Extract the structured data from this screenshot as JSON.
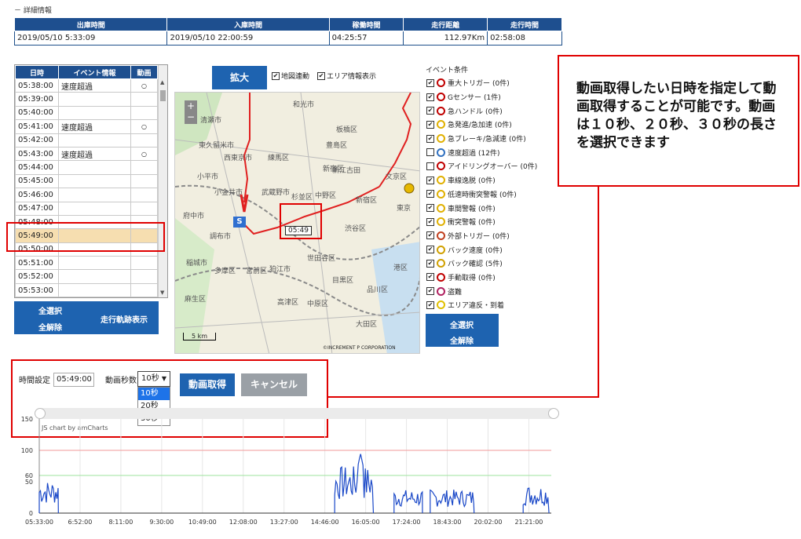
{
  "detail": {
    "section_label": "－ 詳細情報",
    "headers": [
      "出庫時間",
      "入庫時間",
      "稼働時間",
      "走行距離",
      "走行時間"
    ],
    "values": [
      "2019/05/10 5:33:09",
      "2019/05/10 22:00:59",
      "04:25:57",
      "112.97Km",
      "02:58:08"
    ]
  },
  "events": {
    "headers": [
      "日時",
      "イベント情報",
      "動画"
    ],
    "rows": [
      {
        "time": "05:38:00",
        "event": "速度超過",
        "video": "○"
      },
      {
        "time": "05:39:00",
        "event": "",
        "video": ""
      },
      {
        "time": "05:40:00",
        "event": "",
        "video": ""
      },
      {
        "time": "05:41:00",
        "event": "速度超過",
        "video": "○"
      },
      {
        "time": "05:42:00",
        "event": "",
        "video": ""
      },
      {
        "time": "05:43:00",
        "event": "速度超過",
        "video": "○"
      },
      {
        "time": "05:44:00",
        "event": "",
        "video": ""
      },
      {
        "time": "05:45:00",
        "event": "",
        "video": ""
      },
      {
        "time": "05:46:00",
        "event": "",
        "video": ""
      },
      {
        "time": "05:47:00",
        "event": "",
        "video": ""
      },
      {
        "time": "05:48:00",
        "event": "",
        "video": ""
      },
      {
        "time": "05:49:00",
        "event": "",
        "video": ""
      },
      {
        "time": "05:50:00",
        "event": "",
        "video": ""
      },
      {
        "time": "05:51:00",
        "event": "",
        "video": ""
      },
      {
        "time": "05:52:00",
        "event": "",
        "video": ""
      },
      {
        "time": "05:53:00",
        "event": "",
        "video": ""
      }
    ],
    "selected_index": 11,
    "select_all": "全選択",
    "clear_all": "全解除",
    "show_track": "走行軌跡表示"
  },
  "map": {
    "expand": "拡大",
    "sync_label": "地図連動",
    "area_label": "エリア情報表示",
    "sync_checked": true,
    "area_checked": true,
    "start_marker": "S",
    "time_marker": "05:49",
    "scale": "5 km",
    "copyright": "©INCREMENT P CORPORATION",
    "place_labels": [
      "清瀬市",
      "和光市",
      "板橋区",
      "東久留米市",
      "西東京市",
      "練馬区",
      "小平市",
      "豊島区",
      "小金井市",
      "武蔵野市",
      "新宿区",
      "中野区",
      "府中市",
      "調布市",
      "杉並区",
      "渋谷区",
      "世田谷区",
      "稲城市",
      "多摩区",
      "狛江市",
      "宮前区",
      "目黒区",
      "品川区",
      "麻生区",
      "高津区",
      "大田区",
      "中原区",
      "新宿区",
      "文京区",
      "港区",
      "新江古田",
      "東京"
    ],
    "zoom_in": "+",
    "zoom_out": "−"
  },
  "conditions": {
    "title": "イベント条件",
    "items": [
      {
        "label": "重大トリガー",
        "count": "(0件)",
        "checked": true,
        "color": "#c00000"
      },
      {
        "label": "Gセンサー",
        "count": "(1件)",
        "checked": true,
        "color": "#c00000"
      },
      {
        "label": "急ハンドル",
        "count": "(0件)",
        "checked": true,
        "color": "#c00000"
      },
      {
        "label": "急発進/急加速",
        "count": "(0件)",
        "checked": true,
        "color": "#e0b000"
      },
      {
        "label": "急ブレーキ/急減速",
        "count": "(0件)",
        "checked": true,
        "color": "#e0b000"
      },
      {
        "label": "速度超過",
        "count": "(12件)",
        "checked": false,
        "color": "#3070c0"
      },
      {
        "label": "アイドリングオーバー",
        "count": "(0件)",
        "checked": false,
        "color": "#c00000"
      },
      {
        "label": "車線逸脱",
        "count": "(0件)",
        "checked": true,
        "color": "#e0b000"
      },
      {
        "label": "低速時衝突警報",
        "count": "(0件)",
        "checked": true,
        "color": "#e0b000"
      },
      {
        "label": "車間警報",
        "count": "(0件)",
        "checked": true,
        "color": "#e0b000"
      },
      {
        "label": "衝突警報",
        "count": "(0件)",
        "checked": true,
        "color": "#e0b000"
      },
      {
        "label": "外部トリガー",
        "count": "(0件)",
        "checked": true,
        "color": "#c04020"
      },
      {
        "label": "バック速度",
        "count": "(0件)",
        "checked": true,
        "color": "#d0a000"
      },
      {
        "label": "バック確認",
        "count": "(5件)",
        "checked": true,
        "color": "#d0a000"
      },
      {
        "label": "手動取得",
        "count": "(0件)",
        "checked": true,
        "color": "#c00000"
      },
      {
        "label": "盗難",
        "count": "",
        "checked": true,
        "color": "#b02060"
      },
      {
        "label": "エリア違反・到着",
        "count": "",
        "checked": true,
        "color": "#e0c000"
      }
    ],
    "select_all": "全選択",
    "clear_all": "全解除"
  },
  "callout": {
    "text": "動画取得したい日時を指定して動画取得することが可能です。動画は１０秒、２０秒、３０秒の長さを選択できます"
  },
  "video": {
    "time_label": "時間設定",
    "time_value": "05:49:00",
    "sec_label": "動画秒数",
    "sec_selected": "10秒",
    "sec_options": [
      "10秒",
      "20秒",
      "30秒"
    ],
    "get_button": "動画取得",
    "cancel_button": "キャンセル"
  },
  "chart_data": {
    "type": "line",
    "credit": "JS chart by amCharts",
    "y_ticks": [
      0,
      50,
      60,
      100,
      150
    ],
    "ylim": [
      0,
      150
    ],
    "x_ticks": [
      "05:33:00",
      "6:52:00",
      "8:11:00",
      "9:30:00",
      "10:49:00",
      "12:08:00",
      "13:27:00",
      "14:46:00",
      "16:05:00",
      "17:24:00",
      "18:43:00",
      "20:02:00",
      "21:21:00"
    ],
    "threshold_lines": [
      {
        "value": 100,
        "color": "#f29a9a"
      },
      {
        "value": 60,
        "color": "#9ee39e"
      }
    ],
    "series_color": "#1a48c8",
    "segments": [
      {
        "start": "05:33:00",
        "end": "06:10:00",
        "level": 35
      },
      {
        "start": "15:05:00",
        "end": "16:20:00",
        "level": 50
      },
      {
        "start": "17:00:00",
        "end": "17:55:00",
        "level": 25
      },
      {
        "start": "18:10:00",
        "end": "19:35:00",
        "level": 25
      },
      {
        "start": "21:10:00",
        "end": "22:00:00",
        "level": 30
      }
    ],
    "peaks": [
      {
        "x": "15:55:00",
        "y": 95
      }
    ]
  }
}
